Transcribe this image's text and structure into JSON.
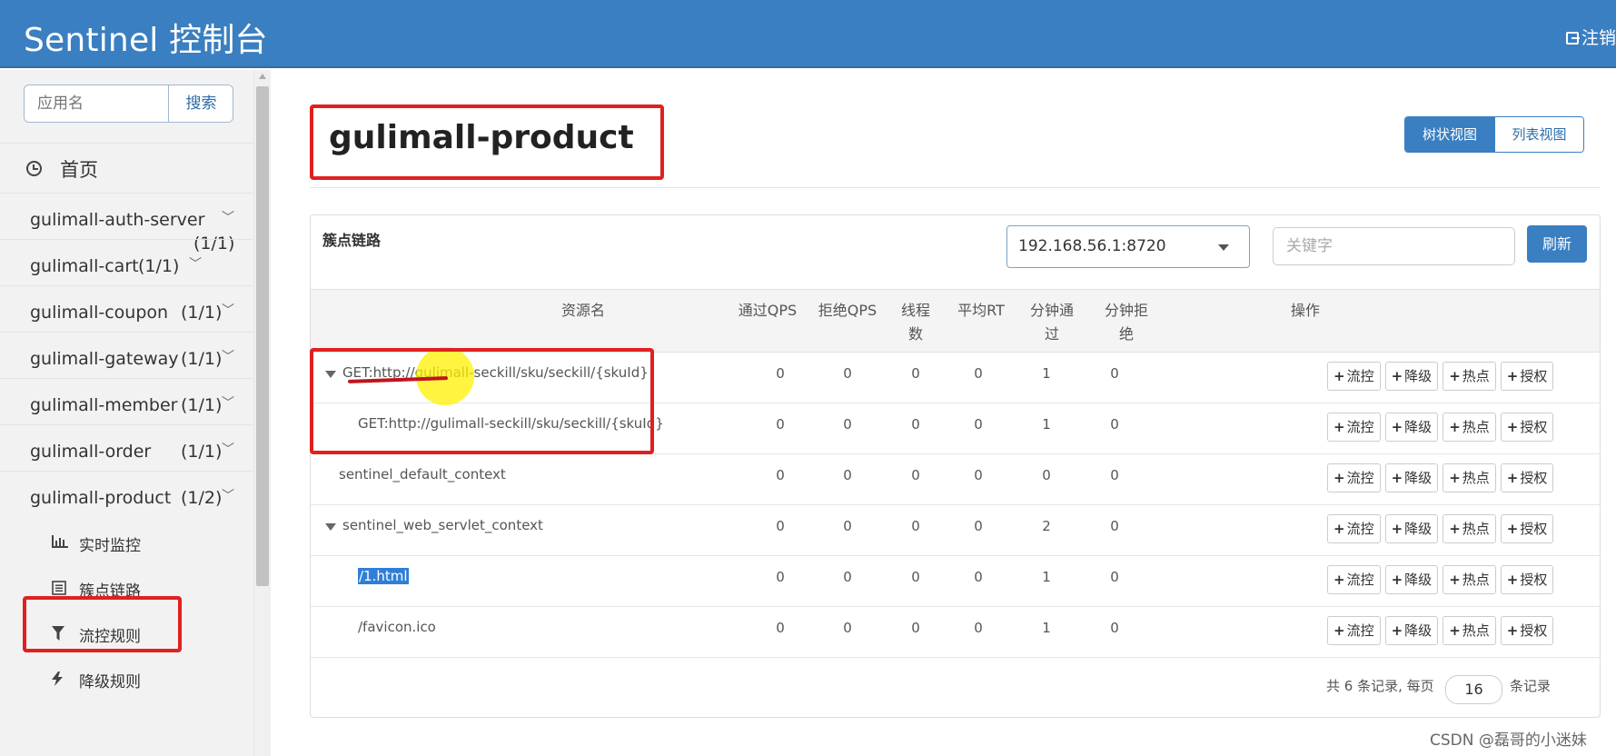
{
  "header": {
    "brand": "Sentinel 控制台",
    "logout_label": "注销"
  },
  "sidebar": {
    "search_placeholder": "应用名",
    "search_button": "搜索",
    "home_label": "首页",
    "apps": [
      {
        "name": "gulimall-auth-server",
        "count": "(1/1)"
      },
      {
        "name": "gulimall-cart",
        "count": "(1/1)"
      },
      {
        "name": "gulimall-coupon",
        "count": "(1/1)"
      },
      {
        "name": "gulimall-gateway",
        "count": "(1/1)"
      },
      {
        "name": "gulimall-member",
        "count": "(1/1)"
      },
      {
        "name": "gulimall-order",
        "count": "(1/1)"
      },
      {
        "name": "gulimall-product",
        "count": "(1/2)"
      }
    ],
    "sub_items": [
      {
        "label": "实时监控",
        "icon": "bar-chart-icon"
      },
      {
        "label": "簇点链路",
        "icon": "list-icon"
      },
      {
        "label": "流控规则",
        "icon": "filter-icon"
      },
      {
        "label": "降级规则",
        "icon": "flash-icon"
      }
    ]
  },
  "main": {
    "app_title": "gulimall-product",
    "view_toggle": {
      "tree": "树状视图",
      "list": "列表视图"
    },
    "panel_title": "簇点链路",
    "machine_select": "192.168.56.1:8720",
    "keyword_placeholder": "关键字",
    "refresh_button": "刷新",
    "columns": {
      "resource": "资源名",
      "pass_qps": "通过QPS",
      "block_qps": "拒绝QPS",
      "threads": "线程数",
      "avg_rt": "平均RT",
      "minute_pass": "分钟通过",
      "minute_block": "分钟拒绝",
      "ops": "操作"
    },
    "op_labels": {
      "flow": "流控",
      "degrade": "降级",
      "hot": "热点",
      "auth": "授权"
    },
    "rows": [
      {
        "resource": "GET:http://gulimall-seckill/sku/seckill/{skuId}",
        "pass_qps": "0",
        "block_qps": "0",
        "threads": "0",
        "avg_rt": "0",
        "minute_pass": "1",
        "minute_block": "0"
      },
      {
        "resource": "GET:http://gulimall-seckill/sku/seckill/{skuId}",
        "pass_qps": "0",
        "block_qps": "0",
        "threads": "0",
        "avg_rt": "0",
        "minute_pass": "1",
        "minute_block": "0"
      },
      {
        "resource": "sentinel_default_context",
        "pass_qps": "0",
        "block_qps": "0",
        "threads": "0",
        "avg_rt": "0",
        "minute_pass": "0",
        "minute_block": "0"
      },
      {
        "resource": "sentinel_web_servlet_context",
        "pass_qps": "0",
        "block_qps": "0",
        "threads": "0",
        "avg_rt": "0",
        "minute_pass": "2",
        "minute_block": "0"
      },
      {
        "resource": "/1.html",
        "pass_qps": "0",
        "block_qps": "0",
        "threads": "0",
        "avg_rt": "0",
        "minute_pass": "1",
        "minute_block": "0"
      },
      {
        "resource": "/favicon.ico",
        "pass_qps": "0",
        "block_qps": "0",
        "threads": "0",
        "avg_rt": "0",
        "minute_pass": "1",
        "minute_block": "0"
      }
    ],
    "pager": {
      "prefix": "共 6 条记录, 每页",
      "page_size": "16",
      "suffix": "条记录"
    }
  },
  "watermark": "CSDN @磊哥的小迷妹",
  "colors": {
    "header": "#3a7fc1",
    "annotation": "#e02020"
  }
}
